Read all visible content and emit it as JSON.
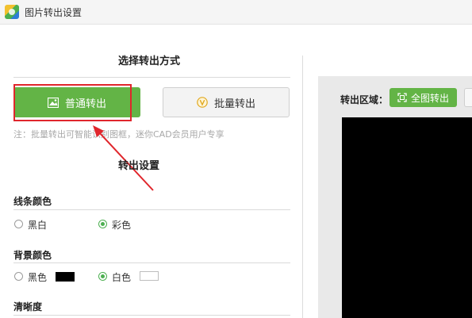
{
  "window": {
    "title": "图片转出设置",
    "icon": "app-logo-icon"
  },
  "mode": {
    "heading": "选择转出方式",
    "normal_label": "普通转出",
    "normal_icon": "image-icon",
    "batch_label": "批量转出",
    "batch_icon": "v-badge-icon",
    "note": "注：批量转出可智能识别图框，迷你CAD会员用户专享"
  },
  "settings": {
    "heading": "转出设置",
    "line_color": {
      "label": "线条颜色",
      "options": [
        {
          "label": "黑白",
          "checked": false
        },
        {
          "label": "彩色",
          "checked": true
        }
      ]
    },
    "bg_color": {
      "label": "背景颜色",
      "options": [
        {
          "label": "黑色",
          "checked": false,
          "swatch": "#000000"
        },
        {
          "label": "白色",
          "checked": true,
          "swatch": "#ffffff"
        }
      ]
    },
    "clarity": {
      "label": "清晰度"
    }
  },
  "export_area": {
    "label": "转出区域：",
    "full_button": "全图转出",
    "full_icon": "frame-icon"
  },
  "colors": {
    "accent_green": "#63b446",
    "highlight_red": "#e0262c",
    "preview_bg": "#000000"
  }
}
